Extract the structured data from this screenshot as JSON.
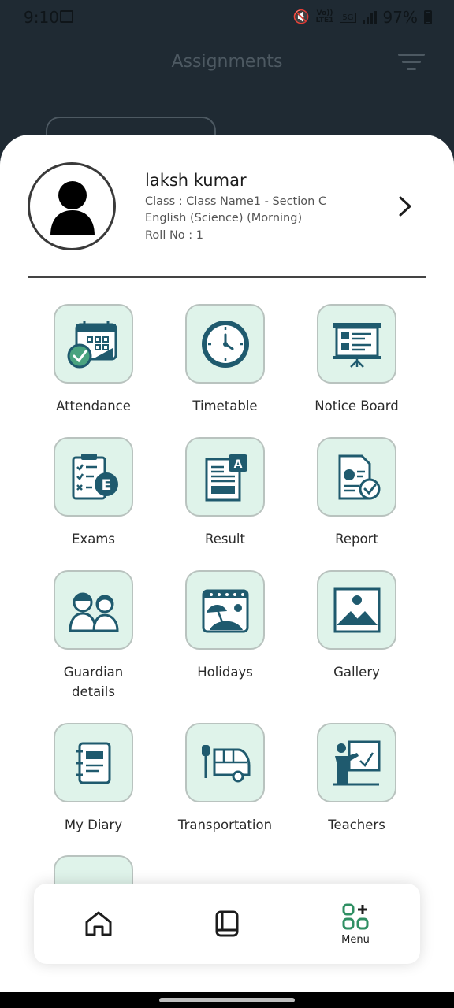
{
  "status_bar": {
    "time": "9:10",
    "network_top": "Vo))",
    "network_bottom": "LTE1",
    "network_badge": "5G",
    "battery": "97%"
  },
  "header": {
    "title": "Assignments"
  },
  "profile": {
    "name": "laksh kumar",
    "class_line": "Class : Class Name1 - Section C",
    "medium_line": "English (Science) (Morning)",
    "roll_line": "Roll No : 1"
  },
  "menu": {
    "items": [
      {
        "label": "Attendance",
        "icon": "calendar-check-icon"
      },
      {
        "label": "Timetable",
        "icon": "clock-icon"
      },
      {
        "label": "Notice Board",
        "icon": "presentation-board-icon"
      },
      {
        "label": "Exams",
        "icon": "exam-clipboard-icon"
      },
      {
        "label": "Result",
        "icon": "result-document-icon"
      },
      {
        "label": "Report",
        "icon": "report-document-icon"
      },
      {
        "label": "Guardian details",
        "icon": "guardians-icon"
      },
      {
        "label": "Holidays",
        "icon": "beach-calendar-icon"
      },
      {
        "label": "Gallery",
        "icon": "gallery-image-icon"
      },
      {
        "label": "My Diary",
        "icon": "diary-icon"
      },
      {
        "label": "Transportation",
        "icon": "bus-stop-icon"
      },
      {
        "label": "Teachers",
        "icon": "teacher-icon"
      }
    ]
  },
  "bottom_nav": {
    "menu_label": "Menu"
  },
  "colors": {
    "accent": "#1f5a6e",
    "tile_bg": "#dff3ea",
    "header_bg": "#1f2a33"
  }
}
